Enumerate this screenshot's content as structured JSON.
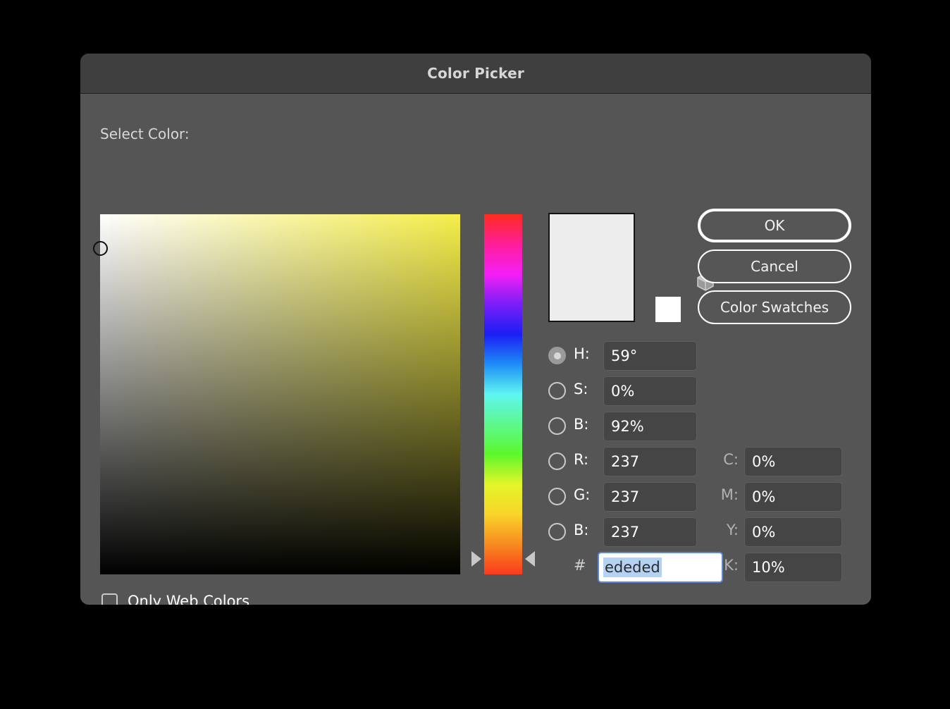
{
  "window": {
    "title": "Color Picker"
  },
  "main": {
    "select_color_label": "Select Color:",
    "preview_color": "#ededed",
    "web_safe_swatch_color": "#ffffff",
    "field_base_hue_color": "#f5ee4a",
    "gamut_icon": "cube-icon"
  },
  "buttons": {
    "ok": "OK",
    "cancel": "Cancel",
    "color_swatches": "Color Swatches"
  },
  "hsb_fields": [
    {
      "name": "hue",
      "label": "H:",
      "value": "59°",
      "selected": true
    },
    {
      "name": "saturation",
      "label": "S:",
      "value": "0%",
      "selected": false
    },
    {
      "name": "brightness",
      "label": "B:",
      "value": "92%",
      "selected": false
    },
    {
      "name": "red",
      "label": "R:",
      "value": "237",
      "selected": false
    },
    {
      "name": "green",
      "label": "G:",
      "value": "237",
      "selected": false
    },
    {
      "name": "blue",
      "label": "B:",
      "value": "237",
      "selected": false
    }
  ],
  "cmyk_fields": [
    {
      "name": "cyan",
      "label": "C:",
      "value": "0%"
    },
    {
      "name": "magenta",
      "label": "M:",
      "value": "0%"
    },
    {
      "name": "yellow",
      "label": "Y:",
      "value": "0%"
    },
    {
      "name": "black",
      "label": "K:",
      "value": "10%"
    }
  ],
  "hex": {
    "label": "#",
    "value": "ededed",
    "focused": true,
    "selected": true
  },
  "options": {
    "only_web_colors_label": "Only Web Colors",
    "only_web_colors_checked": false
  },
  "colors": {
    "dialog_background": "#555555",
    "titlebar_background": "#3f3f3f",
    "input_background": "#454545",
    "focus_border": "#5b87d6",
    "selection_highlight": "#b6d2f2"
  }
}
